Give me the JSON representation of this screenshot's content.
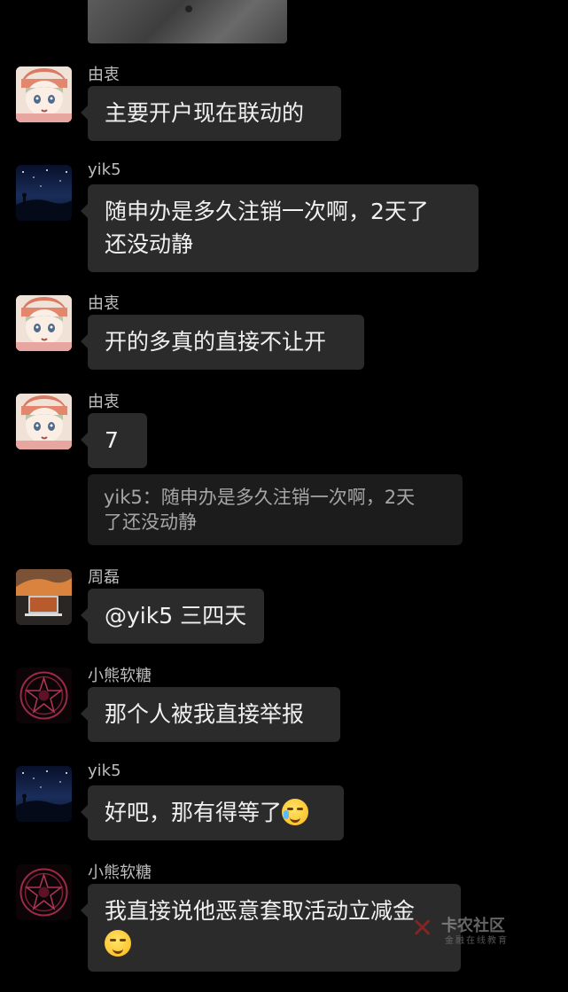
{
  "messages": [
    {
      "sender": "由衷",
      "avatar": "girl-avatar",
      "text": "主要开户现在联动的"
    },
    {
      "sender": "yik5",
      "avatar": "night-sky-avatar",
      "line1": "随申办是多久注销一次啊，2天了",
      "line2": "还没动静"
    },
    {
      "sender": "由衷",
      "avatar": "girl-avatar",
      "text": "开的多真的直接不让开"
    },
    {
      "sender": "由衷",
      "avatar": "girl-avatar",
      "text": "7",
      "quote_line1": "yik5：随申办是多久注销一次啊，2天",
      "quote_line2": "了还没动静"
    },
    {
      "sender": "周磊",
      "avatar": "laptop-avatar",
      "text": "@yik5 三四天"
    },
    {
      "sender": "小熊软糖",
      "avatar": "sigil-avatar",
      "text": "那个人被我直接举报"
    },
    {
      "sender": "yik5",
      "avatar": "night-sky-avatar",
      "text": "好吧，那有得等了",
      "emoji": "crying-laughing-emoji"
    },
    {
      "sender": "小熊软糖",
      "avatar": "sigil-avatar",
      "text": "我直接说他恶意套取活动立减金",
      "emoji": "smirk-emoji"
    }
  ],
  "watermark": {
    "name": "卡农社区",
    "slogan": "金融在线教育"
  },
  "colors": {
    "background": "#000000",
    "bubble": "#2b2b2b",
    "quote": "#1c1c1c",
    "sender": "#bcbcbc"
  }
}
